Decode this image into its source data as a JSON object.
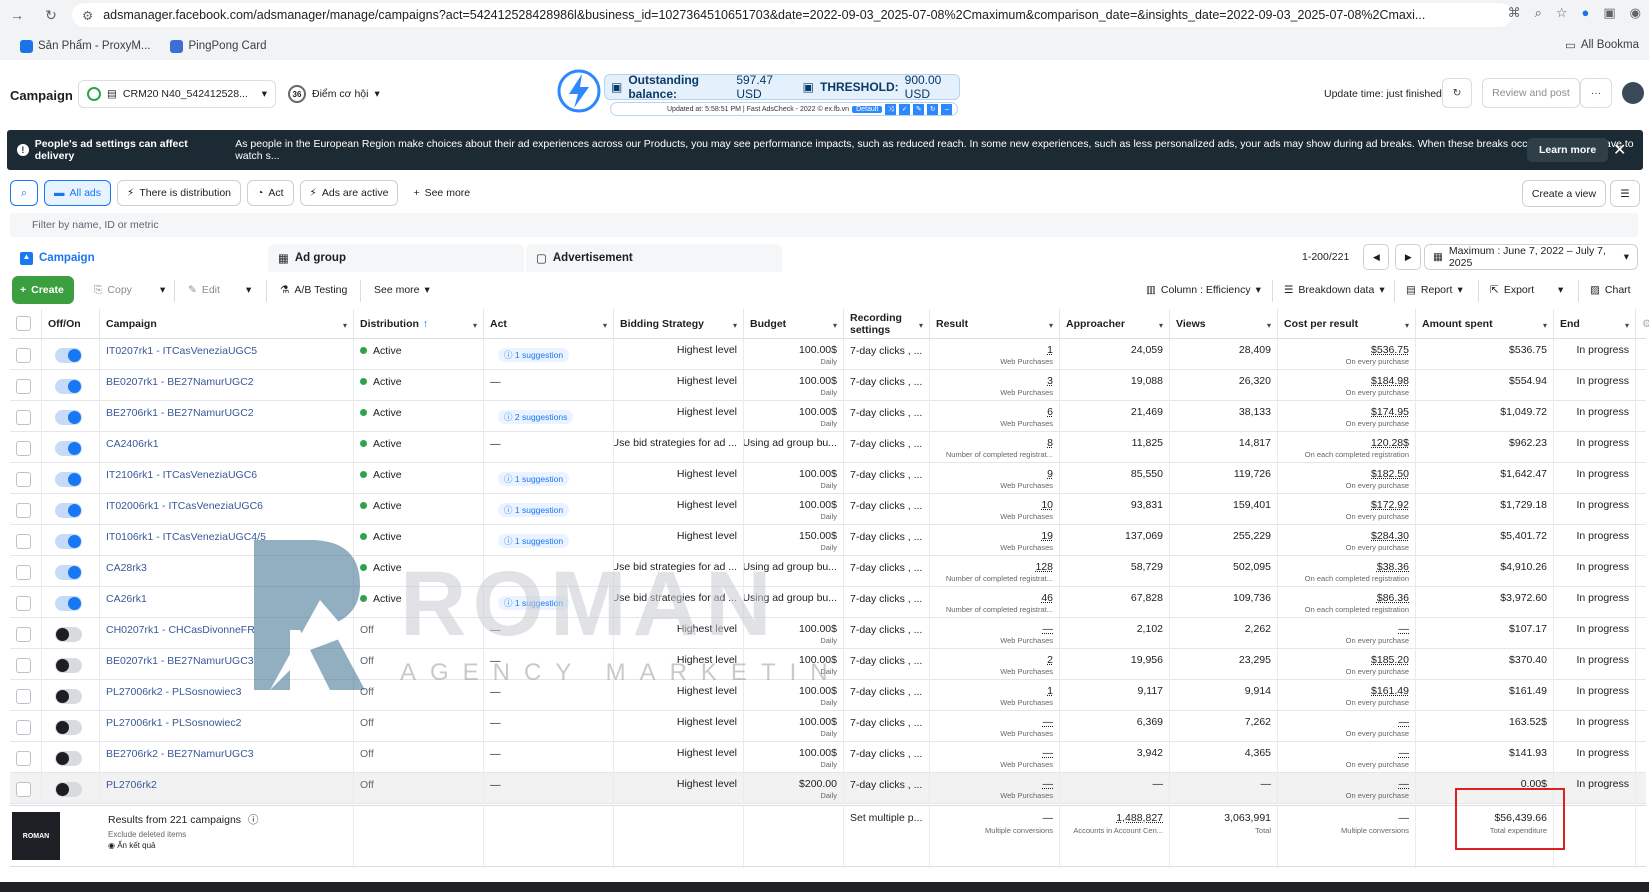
{
  "browser": {
    "url": "adsmanager.facebook.com/adsmanager/manage/campaigns?act=542412528428986l&business_id=1027364510651703&date=2022-09-03_2025-07-08%2Cmaximum&comparison_date=&insights_date=2022-09-03_2025-07-08%2Cmaxi...",
    "bookmarks": [
      "Sản Phẩm - ProxyM...",
      "PingPong Card"
    ],
    "all_bookmarks": "All Bookma"
  },
  "header": {
    "title": "Campaign",
    "account": "CRM20 N40_542412528...",
    "points_badge": "36",
    "points_label": "Điểm cơ hội",
    "balance_label": "Outstanding balance:",
    "balance_value": "597.47 USD",
    "threshold_label": "THRESHOLD:",
    "threshold_value": "900.00 USD",
    "updated_text": "Updated at: 5:58:51 PM | Fast AdsCheck - 2022 © ex.fb.vn",
    "default_label": "Default",
    "update_time": "Update time: just finished",
    "review_btn": "Review and post",
    "more_btn": "···"
  },
  "banner": {
    "title": "People's ad settings can affect delivery",
    "text": "As people in the European Region make choices about their ad experiences across our Products, you may see performance impacts, such as reduced reach. In some new experiences, such as less personalized ads, your ads may show during ad breaks. When these breaks occur, people may have to watch s...",
    "learn_more": "Learn more"
  },
  "filters": {
    "all_ads": "All ads",
    "distribution": "There is distribution",
    "act": "Act",
    "ads_active": "Ads are active",
    "see_more": "See more",
    "create_view": "Create a view",
    "search_placeholder": "Filter by name, ID or metric"
  },
  "tabs": {
    "campaign": "Campaign",
    "ad_group": "Ad group",
    "advertisement": "Advertisement"
  },
  "pager": {
    "range": "1-200/221"
  },
  "date_range": "Maximum : June 7, 2022 – July 7, 2025",
  "toolbar": {
    "create": "Create",
    "copy": "Copy",
    "edit": "Edit",
    "ab": "A/B Testing",
    "see_more": "See more",
    "columns": "Column : Efficiency",
    "breakdown": "Breakdown data",
    "report": "Report",
    "export": "Export",
    "chart": "Chart"
  },
  "columns": [
    "Off/On",
    "Campaign",
    "Distribution",
    "Act",
    "Bidding Strategy",
    "Budget",
    "Recording settings",
    "Result",
    "Approacher",
    "Views",
    "Cost per result",
    "Amount spent",
    "End"
  ],
  "rows": [
    {
      "on": true,
      "name": "IT0207rk1 - ITCasVeneziaUGC5",
      "dist": "Active",
      "act": "1 suggestion",
      "bid": "Highest level",
      "budget": "100.00$",
      "budget_sub": "Daily",
      "rec": "7-day clicks , ...",
      "result": "1",
      "result_sub": "Web Purchases",
      "reach": "24,059",
      "views": "28,409",
      "cpr": "$536.75",
      "cpr_sub": "On every purchase",
      "spent": "$536.75",
      "end": "In progress"
    },
    {
      "on": true,
      "name": "BE0207rk1 - BE27NamurUGC2",
      "dist": "Active",
      "act": "—",
      "bid": "Highest level",
      "budget": "100.00$",
      "budget_sub": "Daily",
      "rec": "7-day clicks , ...",
      "result": "3",
      "result_sub": "Web Purchases",
      "reach": "19,088",
      "views": "26,320",
      "cpr": "$184.98",
      "cpr_sub": "On every purchase",
      "spent": "$554.94",
      "end": "In progress"
    },
    {
      "on": true,
      "name": "BE2706rk1 - BE27NamurUGC2",
      "dist": "Active",
      "act": "2 suggestions",
      "bid": "Highest level",
      "budget": "100.00$",
      "budget_sub": "Daily",
      "rec": "7-day clicks , ...",
      "result": "6",
      "result_sub": "Web Purchases",
      "reach": "21,469",
      "views": "38,133",
      "cpr": "$174.95",
      "cpr_sub": "On every purchase",
      "spent": "$1,049.72",
      "end": "In progress"
    },
    {
      "on": true,
      "name": "CA2406rk1",
      "dist": "Active",
      "act": "—",
      "bid": "Use bid strategies for ad ...",
      "budget": "Using ad group bu...",
      "budget_sub": "",
      "rec": "7-day clicks , ...",
      "result": "8",
      "result_sub": "Number of completed registrat...",
      "reach": "11,825",
      "views": "14,817",
      "cpr": "120.28$",
      "cpr_sub": "On each completed registration",
      "spent": "$962.23",
      "end": "In progress"
    },
    {
      "on": true,
      "name": "IT2106rk1 - ITCasVeneziaUGC6",
      "dist": "Active",
      "act": "1 suggestion",
      "bid": "Highest level",
      "budget": "100.00$",
      "budget_sub": "Daily",
      "rec": "7-day clicks , ...",
      "result": "9",
      "result_sub": "Web Purchases",
      "reach": "85,550",
      "views": "119,726",
      "cpr": "$182.50",
      "cpr_sub": "On every purchase",
      "spent": "$1,642.47",
      "end": "In progress"
    },
    {
      "on": true,
      "name": "IT02006rk1 - ITCasVeneziaUGC6",
      "dist": "Active",
      "act": "1 suggestion",
      "bid": "Highest level",
      "budget": "100.00$",
      "budget_sub": "Daily",
      "rec": "7-day clicks , ...",
      "result": "10",
      "result_sub": "Web Purchases",
      "reach": "93,831",
      "views": "159,401",
      "cpr": "$172.92",
      "cpr_sub": "On every purchase",
      "spent": "$1,729.18",
      "end": "In progress"
    },
    {
      "on": true,
      "name": "IT0106rk1 - ITCasVeneziaUGC4/5",
      "dist": "Active",
      "act": "1 suggestion",
      "bid": "Highest level",
      "budget": "150.00$",
      "budget_sub": "Daily",
      "rec": "7-day clicks , ...",
      "result": "19",
      "result_sub": "Web Purchases",
      "reach": "137,069",
      "views": "255,229",
      "cpr": "$284.30",
      "cpr_sub": "On every purchase",
      "spent": "$5,401.72",
      "end": "In progress"
    },
    {
      "on": true,
      "name": "CA28rk3",
      "dist": "Active",
      "act": "",
      "bid": "Use bid strategies for ad ...",
      "budget": "Using ad group bu...",
      "budget_sub": "",
      "rec": "7-day clicks , ...",
      "result": "128",
      "result_sub": "Number of completed registrat...",
      "reach": "58,729",
      "views": "502,095",
      "cpr": "$38.36",
      "cpr_sub": "On each completed registration",
      "spent": "$4,910.26",
      "end": "In progress"
    },
    {
      "on": true,
      "name": "CA26rk1",
      "dist": "Active",
      "act": "1 suggestion",
      "bid": "Use bid strategies for ad ...",
      "budget": "Using ad group bu...",
      "budget_sub": "",
      "rec": "7-day clicks , ...",
      "result": "46",
      "result_sub": "Number of completed registrat...",
      "reach": "67,828",
      "views": "109,736",
      "cpr": "$86.36",
      "cpr_sub": "On each completed registration",
      "spent": "$3,972.60",
      "end": "In progress"
    },
    {
      "on": false,
      "name": "CH0207rk1 - CHCasDivonneFR",
      "dist": "Off",
      "act": "—",
      "bid": "Highest level",
      "budget": "100.00$",
      "budget_sub": "Daily",
      "rec": "7-day clicks , ...",
      "result": "—",
      "result_sub": "Web Purchases",
      "reach": "2,102",
      "views": "2,262",
      "cpr": "—",
      "cpr_sub": "On every purchase",
      "spent": "$107.17",
      "end": "In progress"
    },
    {
      "on": false,
      "name": "BE0207rk1 - BE27NamurUGC3",
      "dist": "Off",
      "act": "—",
      "bid": "Highest level",
      "budget": "100.00$",
      "budget_sub": "Daily",
      "rec": "7-day clicks , ...",
      "result": "2",
      "result_sub": "Web Purchases",
      "reach": "19,956",
      "views": "23,295",
      "cpr": "$185.20",
      "cpr_sub": "On every purchase",
      "spent": "$370.40",
      "end": "In progress"
    },
    {
      "on": false,
      "name": "PL27006rk2 - PLSosnowiec3",
      "dist": "Off",
      "act": "—",
      "bid": "Highest level",
      "budget": "100.00$",
      "budget_sub": "Daily",
      "rec": "7-day clicks , ...",
      "result": "1",
      "result_sub": "Web Purchases",
      "reach": "9,117",
      "views": "9,914",
      "cpr": "$161.49",
      "cpr_sub": "On every purchase",
      "spent": "$161.49",
      "end": "In progress"
    },
    {
      "on": false,
      "name": "PL27006rk1 - PLSosnowiec2",
      "dist": "Off",
      "act": "—",
      "bid": "Highest level",
      "budget": "100.00$",
      "budget_sub": "Daily",
      "rec": "7-day clicks , ...",
      "result": "—",
      "result_sub": "Web Purchases",
      "reach": "6,369",
      "views": "7,262",
      "cpr": "—",
      "cpr_sub": "On every purchase",
      "spent": "163.52$",
      "end": "In progress"
    },
    {
      "on": false,
      "name": "BE2706rk2 - BE27NamurUGC3",
      "dist": "Off",
      "act": "—",
      "bid": "Highest level",
      "budget": "100.00$",
      "budget_sub": "Daily",
      "rec": "7-day clicks , ...",
      "result": "—",
      "result_sub": "Web Purchases",
      "reach": "3,942",
      "views": "4,365",
      "cpr": "—",
      "cpr_sub": "On every purchase",
      "spent": "$141.93",
      "end": "In progress"
    },
    {
      "on": false,
      "name": "PL2706rk2",
      "dist": "Off",
      "act": "—",
      "bid": "Highest level",
      "budget": "$200.00",
      "budget_sub": "Daily",
      "rec": "7-day clicks , ...",
      "result": "—",
      "result_sub": "Web Purchases",
      "reach": "—",
      "views": "—",
      "cpr": "—",
      "cpr_sub": "On every purchase",
      "spent": "0.00$",
      "end": "In progress"
    }
  ],
  "footer": {
    "title": "Results from 221 campaigns",
    "excl": "Exclude deleted items",
    "hide": "Ẩn kết quả",
    "rec": "Set multiple p...",
    "result": "—",
    "result_sub": "Multiple conversions",
    "reach": "1,488,827",
    "reach_sub": "Accounts in Account Cen...",
    "views": "3,063,991",
    "views_sub": "Total",
    "cpr": "—",
    "cpr_sub": "Multiple conversions",
    "spent": "$56,439.66",
    "spent_sub": "Total expenditure",
    "logo_text": "ROMAN"
  },
  "watermark": {
    "brand": "ROMAN",
    "tagline": "AGENCY MARKETING"
  },
  "colors": {
    "accent": "#1877f2",
    "banner": "#1c2b33",
    "create": "#3b9f3f",
    "active": "#31a24c",
    "highlight_box": "#e02020"
  }
}
